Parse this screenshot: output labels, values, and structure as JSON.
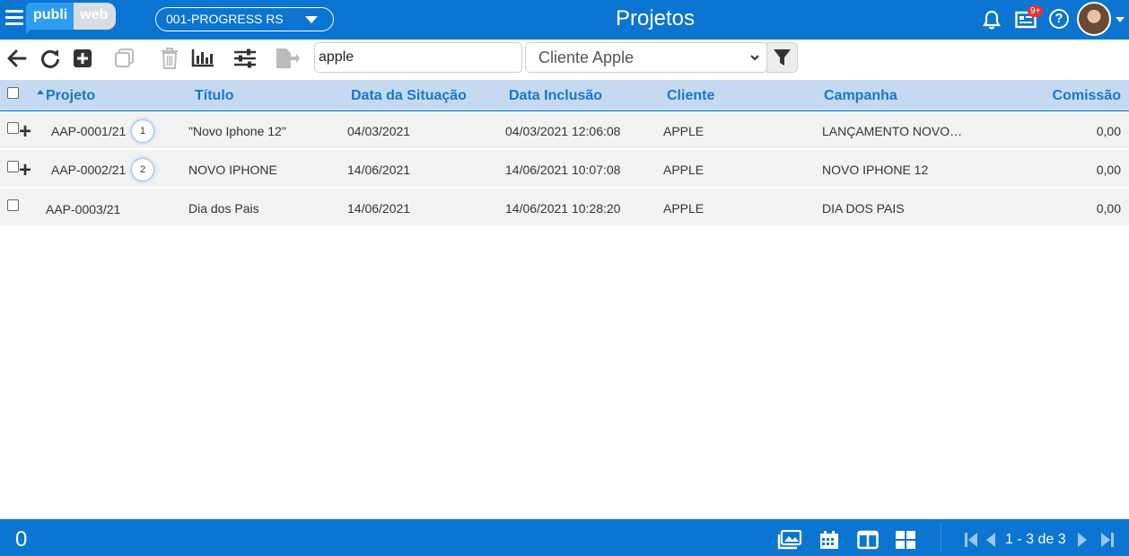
{
  "header": {
    "logo_part1": "publi",
    "logo_part2": "web",
    "company_select": "001-PROGRESS RS",
    "title": "Projetos",
    "notification_badge": "9+"
  },
  "toolbar": {
    "search_value": "apple",
    "client_filter": "Cliente Apple"
  },
  "columns": {
    "projeto": "Projeto",
    "titulo": "Título",
    "data_situacao": "Data da Situação",
    "data_inclusao": "Data Inclusão",
    "cliente": "Cliente",
    "campanha": "Campanha",
    "comissao": "Comissão"
  },
  "rows": [
    {
      "projeto": "AAP-0001/21",
      "sub_count": "1",
      "titulo": "\"Novo Iphone 12\"",
      "data_situacao": "04/03/2021",
      "data_inclusao": "04/03/2021 12:06:08",
      "cliente": "APPLE",
      "campanha": "LANÇAMENTO NOVO…",
      "comissao": "0,00"
    },
    {
      "projeto": "AAP-0002/21",
      "sub_count": "2",
      "titulo": "NOVO IPHONE",
      "data_situacao": "14/06/2021",
      "data_inclusao": "14/06/2021 10:07:08",
      "cliente": "APPLE",
      "campanha": "NOVO IPHONE 12",
      "comissao": "0,00"
    },
    {
      "projeto": "AAP-0003/21",
      "titulo": "Dia dos Pais",
      "data_situacao": "14/06/2021",
      "data_inclusao": "14/06/2021 10:28:20",
      "cliente": "APPLE",
      "campanha": "DIA DOS PAIS",
      "comissao": "0,00"
    }
  ],
  "footer": {
    "selected_count": "0",
    "pagination": "1 - 3 de 3"
  },
  "colors": {
    "primary": "#0b75d1",
    "header_row": "#c5daf0",
    "row_bg": "#f2f2f2"
  }
}
